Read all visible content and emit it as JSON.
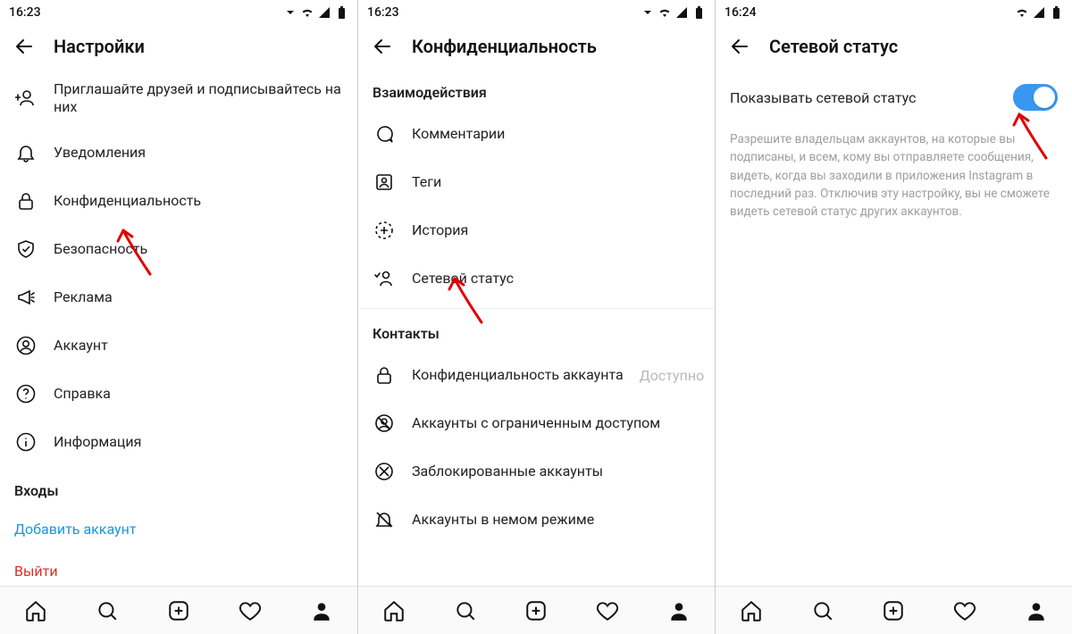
{
  "screen1": {
    "time": "16:23",
    "title": "Настройки",
    "items": {
      "invite": "Приглашайте друзей и подписывайтесь на них",
      "notifications": "Уведомления",
      "privacy": "Конфиденциальность",
      "security": "Безопасность",
      "ads": "Реклама",
      "account": "Аккаунт",
      "help": "Справка",
      "about": "Информация"
    },
    "section_logins": "Входы",
    "add_account": "Добавить аккаунт",
    "logout": "Выйти"
  },
  "screen2": {
    "time": "16:23",
    "title": "Конфиденциальность",
    "section_interactions": "Взаимодействия",
    "items": {
      "comments": "Комментарии",
      "tags": "Теги",
      "story": "История",
      "activity_status": "Сетевой статус"
    },
    "section_contacts": "Контакты",
    "contacts": {
      "account_privacy": "Конфиденциальность аккаунта",
      "account_privacy_value": "Доступно",
      "restricted": "Аккаунты с ограниченным доступом",
      "blocked": "Заблокированные аккаунты",
      "muted": "Аккаунты в немом режиме"
    }
  },
  "screen3": {
    "time": "16:24",
    "title": "Сетевой статус",
    "toggle_label": "Показывать сетевой статус",
    "description": "Разрешите владельцам аккаунтов, на которые вы подписаны, и всем, кому вы отправляете сообщения, видеть, когда вы заходили в приложения Instagram в последний раз. Отключив эту настройку, вы не сможете видеть сетевой статус других аккаунтов."
  }
}
